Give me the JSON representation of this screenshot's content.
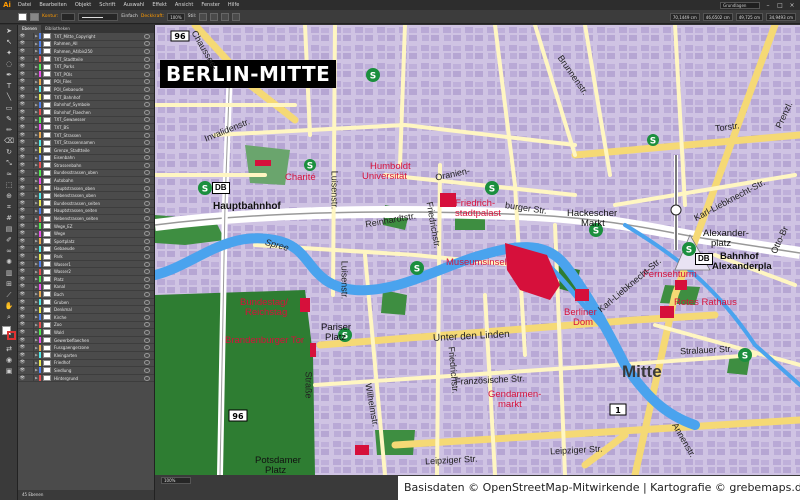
{
  "app": {
    "logo": "Ai",
    "menu": [
      "Datei",
      "Bearbeiten",
      "Objekt",
      "Schrift",
      "Auswahl",
      "Effekt",
      "Ansicht",
      "Fenster",
      "Hilfe"
    ],
    "workspace": "Grundlagen",
    "window_buttons": [
      "–",
      "□",
      "×"
    ]
  },
  "control_bar": {
    "stroke_label": "Kontur:",
    "stroke_style": "Einfach",
    "opacity_label": "Deckkraft:",
    "opacity": "100%",
    "style_label": "Stil:",
    "x": "70,1449 cm",
    "y": "46,6502 cm",
    "w": "49,725 cm",
    "h": "34,9493 cm"
  },
  "layers_panel": {
    "tabs": [
      "Ebenen",
      "Bibliotheken"
    ],
    "footer": "45 Ebenen",
    "selected_index": 49,
    "rows": [
      {
        "name": "TXT_Mitte_Copyright",
        "color": "#4f7fe8"
      },
      {
        "name": "Rahmen_All",
        "color": "#4f7fe8"
      },
      {
        "name": "Rahmen_A4/bis250",
        "color": "#4f7fe8"
      },
      {
        "name": "TXT_Stadtteile",
        "color": "#e84f4f"
      },
      {
        "name": "TXT_Parks",
        "color": "#4fe84f"
      },
      {
        "name": "TXT_POIs",
        "color": "#e84fe8"
      },
      {
        "name": "POI_Files",
        "color": "#e8a84f"
      },
      {
        "name": "POI_Gebaeude",
        "color": "#4fe8e8"
      },
      {
        "name": "TXT_Bahnhof",
        "color": "#e8e84f"
      },
      {
        "name": "Bahnhof_Symbole",
        "color": "#4f7fe8"
      },
      {
        "name": "Bahnhof_Flaechen",
        "color": "#e84f4f"
      },
      {
        "name": "TXT_Gewaesser",
        "color": "#4fe84f"
      },
      {
        "name": "TXT_BS",
        "color": "#e84fe8"
      },
      {
        "name": "TXT_Strassen",
        "color": "#e8a84f"
      },
      {
        "name": "TXT_Strassennamen",
        "color": "#4fe8e8"
      },
      {
        "name": "Grenze_Stadtteile",
        "color": "#e8e84f"
      },
      {
        "name": "Eisenbahn",
        "color": "#4f7fe8"
      },
      {
        "name": "Strassenbahn",
        "color": "#e84f4f"
      },
      {
        "name": "Bundesstrassen_oben",
        "color": "#4fe84f"
      },
      {
        "name": "Autobahn",
        "color": "#e84fe8"
      },
      {
        "name": "Hauptstrassen_oben",
        "color": "#e8a84f"
      },
      {
        "name": "Nebenstrassen_oben",
        "color": "#4fe8e8"
      },
      {
        "name": "Bundesstrassen_seiten",
        "color": "#e8e84f"
      },
      {
        "name": "Hauptstrassen_seiten",
        "color": "#4f7fe8"
      },
      {
        "name": "Nebenstrassen_seiten",
        "color": "#e84f4f"
      },
      {
        "name": "Wege_EZ",
        "color": "#4fe84f"
      },
      {
        "name": "Wege",
        "color": "#e84fe8"
      },
      {
        "name": "Sportplatz",
        "color": "#e8a84f"
      },
      {
        "name": "Gebaeude",
        "color": "#4fe8e8"
      },
      {
        "name": "Park",
        "color": "#e8e84f"
      },
      {
        "name": "Wasser1",
        "color": "#4f7fe8"
      },
      {
        "name": "Wasser2",
        "color": "#e84f4f"
      },
      {
        "name": "Platz",
        "color": "#4fe84f"
      },
      {
        "name": "Kanal",
        "color": "#e84fe8"
      },
      {
        "name": "Bach",
        "color": "#e8a84f"
      },
      {
        "name": "Gruben",
        "color": "#4fe8e8"
      },
      {
        "name": "Denkmal",
        "color": "#e8e84f"
      },
      {
        "name": "Kirche",
        "color": "#4f7fe8"
      },
      {
        "name": "Zoo",
        "color": "#e84f4f"
      },
      {
        "name": "Wald",
        "color": "#4fe84f"
      },
      {
        "name": "Gewerbeflaechen",
        "color": "#e84fe8"
      },
      {
        "name": "Fussgaengerzone",
        "color": "#e8a84f"
      },
      {
        "name": "Kleingarten",
        "color": "#4fe8e8"
      },
      {
        "name": "Friedhof",
        "color": "#e8e84f"
      },
      {
        "name": "Siedlung",
        "color": "#4f7fe8"
      },
      {
        "name": "Hintergrund",
        "color": "#e84f4f"
      }
    ]
  },
  "map": {
    "title": "BERLIN-MITTE",
    "district": "Mitte",
    "road_shields": [
      "96",
      "96",
      "1"
    ],
    "streets": {
      "invalidenstr": "Invalidenstr.",
      "torstr": "Torstr.",
      "luisenstr": "Luisenstr.",
      "luisenstr2": "Luisenstr.",
      "reinhardtstr": "Reinhardtstr.",
      "friedrichstr": "Friedrichstr.",
      "friedrichstr2": "Friedrichstr.",
      "oranienburgerstr": "Oranien-",
      "burgerstr": "burger Str.",
      "brunnenstr": "Brunnenstr.",
      "kltstr": "Karl-Liebknecht-Str.",
      "kltstr2": "Karl-Liebknecht-Str.",
      "unterdenlinden": "Unter den Linden",
      "wilhelmstr": "Wilhelmstr.",
      "franzoesische": "Französische Str.",
      "leipzigerstr": "Leipziger Str.",
      "leipzigerstr2": "Leipziger Str.",
      "strasse_d_17": "Straße",
      "stralauer": "Stralauer Str.",
      "annenstr": "Annenstr.",
      "ottobraun": "Otto-Br",
      "prenzl": "Prenzl.",
      "spree": "Spree",
      "chauss": "Chaussee-"
    },
    "places": {
      "hbf": "Hauptbahnhof",
      "hackescher": "Hackescher",
      "hackescher2": "Markt",
      "alexplatz": "Alexander-",
      "alexplatz2": "platz",
      "bhf_alex": "Bahnhof",
      "bhf_alex2": "Alexanderpla",
      "pariser": "Pariser",
      "pariser2": "Platz",
      "potsdamer": "Potsdamer",
      "potsdamer2": "Platz"
    },
    "pois": {
      "charite": "Charité",
      "humboldt": "Humboldt",
      "humboldt2": "Universität",
      "friedrichstadtpalast": "Friedrich-",
      "friedrichstadtpalast2": "stadtpalast",
      "museumsinsel": "Museumsinsel",
      "fernsehturm": "Fernsehturm",
      "rotesrathaus": "Rotes Rathaus",
      "berlinerdom": "Berliner",
      "berlinerdom2": "Dom",
      "bundestag": "Bundestag/",
      "bundestag2": "Reichstag",
      "brandenburger": "Brandenburger Tor",
      "gendarmen": "Gendarmen-",
      "gendarmen2": "markt"
    },
    "db_badge": "DB",
    "sbahn": "S",
    "credit": "Basisdaten © OpenStreetMap-Mitwirkende | Kartografie © grebemaps.de"
  },
  "status_bar": {
    "zoom": "100%"
  },
  "colors": {
    "map_bg": "#cfc3e3",
    "road": "#fff6c2",
    "road_major": "#f5d975",
    "river": "#4aa3ee",
    "park": "#2e7d32",
    "poi": "#d6103b",
    "sbahn": "#1b8f3e"
  }
}
